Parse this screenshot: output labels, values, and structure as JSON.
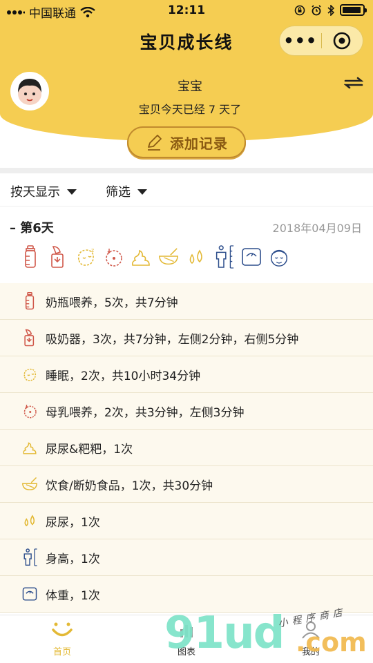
{
  "status_bar": {
    "carrier": "中国联通",
    "time": "12:11"
  },
  "nav": {
    "title": "宝贝成长线",
    "more_label": "•••"
  },
  "profile": {
    "name": "宝宝",
    "days_text": "宝贝今天已经 7 天了"
  },
  "add_record": {
    "label": "添加记录"
  },
  "filters": {
    "display_mode": "按天显示",
    "filter": "筛选"
  },
  "day": {
    "label": "– 第6天",
    "date": "2018年04月09日",
    "icons": [
      "bottle-icon",
      "breast-pump-icon",
      "sleep-icon",
      "breastfeed-icon",
      "poop-icon",
      "food-bowl-icon",
      "pee-icon",
      "height-icon",
      "weight-scale-icon",
      "baby-face-icon"
    ]
  },
  "records": [
    {
      "icon": "bottle-icon",
      "text": "奶瓶喂养，5次，共7分钟"
    },
    {
      "icon": "breast-pump-icon",
      "text": "吸奶器，3次，共7分钟，左侧2分钟，右侧5分钟"
    },
    {
      "icon": "sleep-icon",
      "text": "睡眠，2次，共10小时34分钟"
    },
    {
      "icon": "breastfeed-icon",
      "text": "母乳喂养，2次，共3分钟，左侧3分钟"
    },
    {
      "icon": "poop-icon",
      "text": "尿尿&粑粑，1次"
    },
    {
      "icon": "food-bowl-icon",
      "text": "饮食/断奶食品，1次，共30分钟"
    },
    {
      "icon": "pee-icon",
      "text": "尿尿，1次"
    },
    {
      "icon": "height-icon",
      "text": "身高，1次"
    },
    {
      "icon": "weight-scale-icon",
      "text": "体重，1次"
    }
  ],
  "tabbar": {
    "home": "首页",
    "chart": "图表",
    "mine": "我的"
  },
  "watermark": {
    "main": "91ud",
    "suffix": ".com",
    "tagline": "小程序商店"
  },
  "colors": {
    "header_yellow": "#f5cd52",
    "accent_brown": "#8a5a12",
    "record_bg": "#fdf9ee",
    "icon_red": "#d0584a",
    "icon_yellow": "#e3b935",
    "icon_blue": "#2d4e8c"
  }
}
